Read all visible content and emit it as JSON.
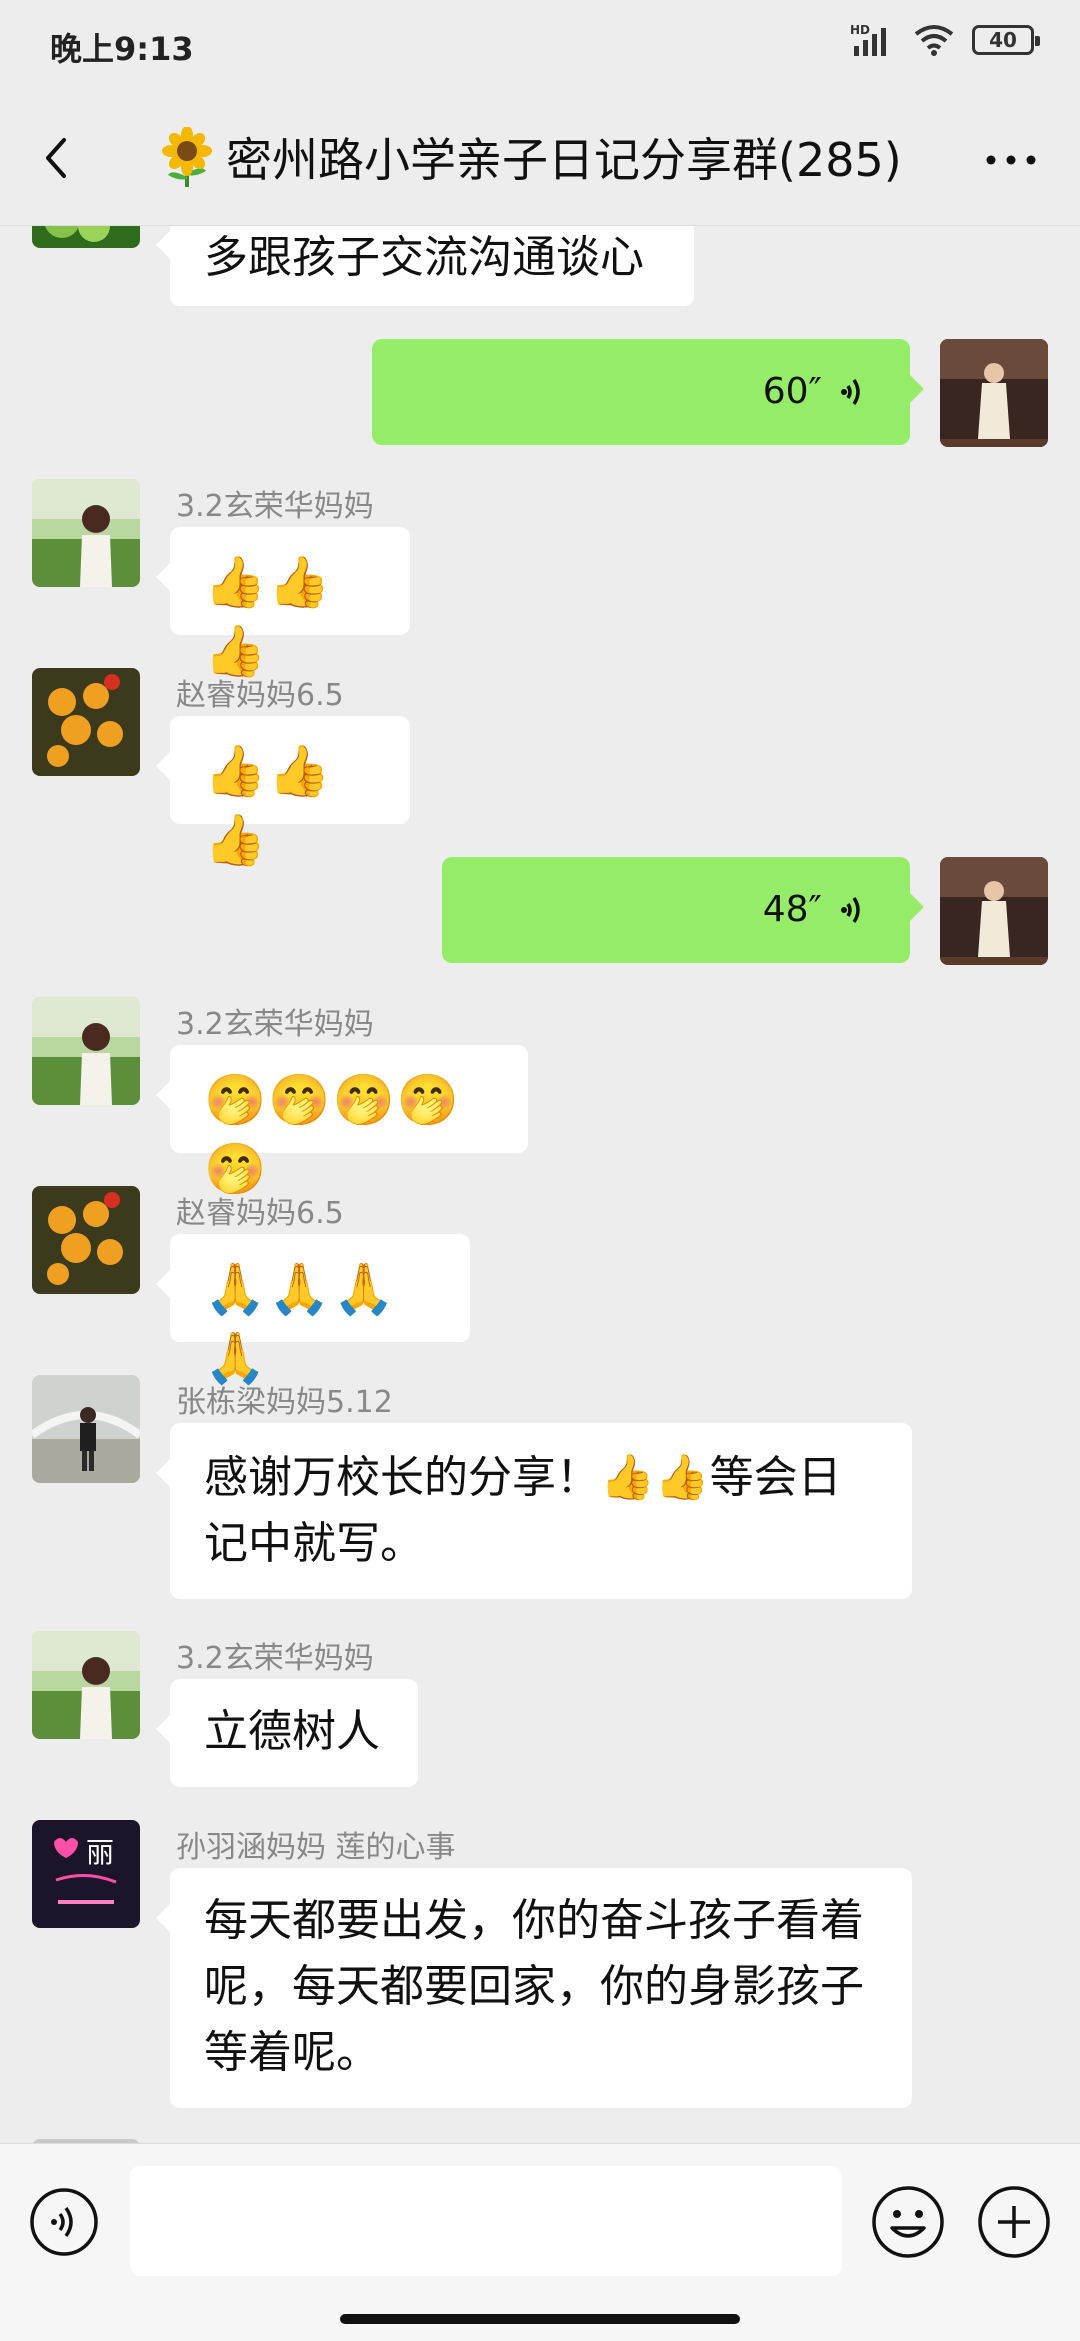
{
  "status": {
    "time": "晚上9:13",
    "battery": "40",
    "network": "HD"
  },
  "header": {
    "title": "密州路小学亲子日记分享群(285)",
    "group_icon": "sunflower-icon"
  },
  "messages": [
    {
      "sender": "",
      "text": "多跟孩子交流沟通谈心"
    },
    {
      "duration": "60″"
    },
    {
      "sender": "3.2玄荣华妈妈",
      "text": "👍👍👍"
    },
    {
      "sender": "赵睿妈妈6.5",
      "text": "👍👍👍"
    },
    {
      "duration": "48″"
    },
    {
      "sender": "3.2玄荣华妈妈",
      "text": "🤭🤭🤭🤭🤭"
    },
    {
      "sender": "赵睿妈妈6.5",
      "text": "🙏🙏🙏🙏"
    },
    {
      "sender": "张栋梁妈妈5.12",
      "text": "感谢万校长的分享！👍👍等会日记中就写。"
    },
    {
      "sender": "3.2玄荣华妈妈",
      "text": "立德树人"
    },
    {
      "sender": "孙羽涵妈妈  莲的心事",
      "text": "每天都要出发，你的奋斗孩子看着呢，每天都要回家，你的身影孩子等着呢。"
    }
  ],
  "avatar_text": {
    "sun": "丽"
  },
  "input": {
    "value": "",
    "placeholder": ""
  },
  "colors": {
    "background": "#ededed",
    "self_bubble": "#95ec69",
    "other_bubble": "#ffffff"
  }
}
